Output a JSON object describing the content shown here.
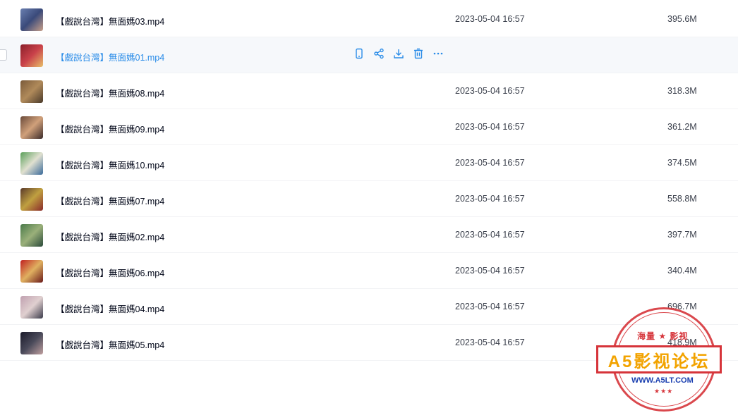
{
  "files": [
    {
      "name": "【戲說台灣】無面媽03.mp4",
      "date": "2023-05-04 16:57",
      "size": "395.6M",
      "thumb_colors": [
        "#6a7fb0",
        "#3a4a7a",
        "#c9a08a"
      ]
    },
    {
      "name": "【戲說台灣】無面媽01.mp4",
      "date": "",
      "size": "",
      "thumb_colors": [
        "#8a1f2a",
        "#c9414a",
        "#e8c06a"
      ],
      "hovered": true
    },
    {
      "name": "【戲說台灣】無面媽08.mp4",
      "date": "2023-05-04 16:57",
      "size": "318.3M",
      "thumb_colors": [
        "#7a5a3a",
        "#b08a5a",
        "#4a3a2a"
      ]
    },
    {
      "name": "【戲說台灣】無面媽09.mp4",
      "date": "2023-05-04 16:57",
      "size": "361.2M",
      "thumb_colors": [
        "#6a4a3a",
        "#d0a07a",
        "#3a2a2a"
      ]
    },
    {
      "name": "【戲說台灣】無面媽10.mp4",
      "date": "2023-05-04 16:57",
      "size": "374.5M",
      "thumb_colors": [
        "#5aa05a",
        "#e0e0d0",
        "#3a6a9a"
      ]
    },
    {
      "name": "【戲說台灣】無面媽07.mp4",
      "date": "2023-05-04 16:57",
      "size": "558.8M",
      "thumb_colors": [
        "#5a3a2a",
        "#c0a040",
        "#8a2a2a"
      ]
    },
    {
      "name": "【戲說台灣】無面媽02.mp4",
      "date": "2023-05-04 16:57",
      "size": "397.7M",
      "thumb_colors": [
        "#4a7a4a",
        "#9ab07a",
        "#2a4a3a"
      ]
    },
    {
      "name": "【戲說台灣】無面媽06.mp4",
      "date": "2023-05-04 16:57",
      "size": "340.4M",
      "thumb_colors": [
        "#c02020",
        "#e0b060",
        "#6a1a1a"
      ]
    },
    {
      "name": "【戲說台灣】無面媽04.mp4",
      "date": "2023-05-04 16:57",
      "size": "696.7M",
      "thumb_colors": [
        "#c0a0b0",
        "#e0d0d0",
        "#3a3a4a"
      ]
    },
    {
      "name": "【戲說台灣】無面媽05.mp4",
      "date": "2023-05-04 16:57",
      "size": "418.9M",
      "thumb_colors": [
        "#1a1a2a",
        "#4a4a5a",
        "#c0a0a0"
      ]
    }
  ],
  "hover_actions": [
    {
      "name": "phone-icon"
    },
    {
      "name": "share-icon"
    },
    {
      "name": "download-icon"
    },
    {
      "name": "delete-icon"
    },
    {
      "name": "more-icon"
    }
  ],
  "accent_color": "#2a8ce8",
  "watermark": {
    "top_text": "海量 ★ 影视",
    "banner": "A5影视论坛",
    "url": "WWW.A5LT.COM",
    "dots": "★★★"
  }
}
